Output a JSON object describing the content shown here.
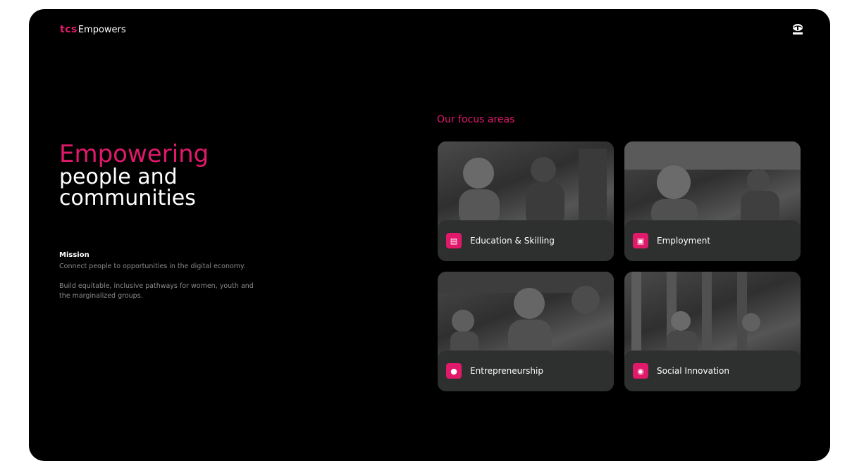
{
  "theme": {
    "accent": "#e1196b",
    "background": "#000000",
    "card_bg": "#2e302f"
  },
  "header": {
    "logo_prefix": "tcs",
    "logo_name": "Empowers",
    "right_icon": "tata-logo-icon"
  },
  "hero": {
    "line1": "Empowering",
    "line2": "people and",
    "line3": "communities"
  },
  "mission": {
    "title": "Mission",
    "paragraph1": "Connect people to opportunities in the digital economy.",
    "paragraph2": "Build equitable, inclusive pathways for women, youth and the marginalized groups."
  },
  "focus": {
    "title": "Our focus areas",
    "cards": [
      {
        "label": "Education & Skilling",
        "icon": "book-icon"
      },
      {
        "label": "Employment",
        "icon": "briefcase-icon"
      },
      {
        "label": "Entrepreneurship",
        "icon": "bulb-icon"
      },
      {
        "label": "Social Innovation",
        "icon": "people-icon"
      }
    ]
  }
}
